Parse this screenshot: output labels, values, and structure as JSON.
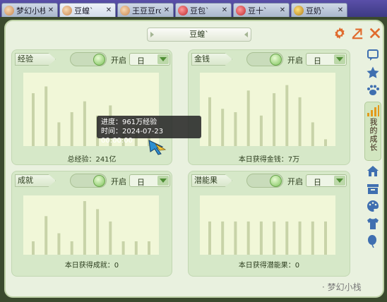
{
  "tabs": [
    {
      "label": "梦幻小栈",
      "icon": "doll-face-icon"
    },
    {
      "label": "豆蝗`",
      "icon": "pet-face-icon"
    },
    {
      "label": "王豆豆ro",
      "icon": "pet-face-icon"
    },
    {
      "label": "豆包`",
      "icon": "pet-face-icon"
    },
    {
      "label": "豆十`",
      "icon": "pet-face-icon"
    },
    {
      "label": "豆奶`",
      "icon": "pet-face-icon"
    }
  ],
  "window": {
    "title": "豆蝗`",
    "buttons": [
      "settings-gear-icon",
      "external-link-icon",
      "close-icon"
    ]
  },
  "panels": {
    "experience": {
      "label": "经验",
      "toggle_text": "开启",
      "select_value": "日",
      "caption": "总经验：241亿",
      "bars": [
        0.78,
        0.88,
        0.35,
        0.5,
        0.66,
        0.45,
        0.6,
        0.3,
        0.42,
        0.15
      ]
    },
    "money": {
      "label": "金钱",
      "toggle_text": "开启",
      "select_value": "日",
      "caption": "本日获得金钱：7万",
      "bars": [
        0.72,
        0.55,
        0.5,
        0.82,
        0.45,
        0.78,
        0.9,
        0.72,
        0.35,
        0.1
      ]
    },
    "achievement": {
      "label": "成就",
      "toggle_text": "开启",
      "select_value": "日",
      "caption": "本日获得成就：0",
      "bars": [
        0.25,
        0.72,
        0.4,
        0.25,
        1.0,
        0.85,
        0.62,
        0.25,
        0.25,
        0.25
      ]
    },
    "potential": {
      "label": "潜能果",
      "toggle_text": "开启",
      "select_value": "日",
      "caption": "本日获得潜能果：0",
      "bars": [
        0.62,
        0.62,
        0.62,
        0.62,
        0.62,
        0.62,
        0.62,
        0.62,
        0.62,
        0.62
      ]
    }
  },
  "tooltip": {
    "progress": "进度：961万经验",
    "time": "时间：2024-07-23 00:00:00"
  },
  "sidebar": {
    "active_tab": "我的成长",
    "icons": [
      "chat-icon",
      "star-icon",
      "paw-icon",
      "bar-chart-icon",
      "house-icon",
      "box-icon",
      "palette-icon",
      "shirt-icon",
      "balloon-icon"
    ]
  },
  "watermark": "· 梦幻小栈",
  "colors": {
    "bar": "#c8d3a8",
    "plot_bg": "#f1f7d8",
    "panel_bg": "#d6e8c8",
    "accent": "#e06b2e"
  }
}
